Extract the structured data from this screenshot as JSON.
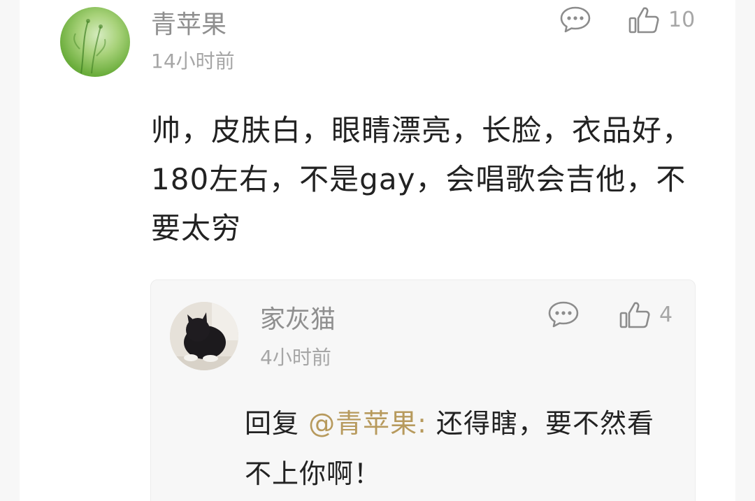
{
  "comment": {
    "username": "青苹果",
    "time": "14小时前",
    "like_count": "10",
    "text": "帅，皮肤白，眼睛漂亮，长脸，衣品好，180左右，不是gay，会唱歌会吉他，不要太穷",
    "icons": {
      "reply": "comment-bubble-icon",
      "like": "thumbs-up-icon"
    }
  },
  "reply": {
    "username": "家灰猫",
    "time": "4小时前",
    "like_count": "4",
    "prefix": "回复",
    "mention": "@青苹果:",
    "text": "还得瞎，要不然看不上你啊！",
    "icons": {
      "reply": "comment-bubble-icon",
      "like": "thumbs-up-icon"
    }
  },
  "colors": {
    "text": "#222222",
    "meta": "#a6a6a6",
    "username": "#8f8f8f",
    "mention": "#b79a5d",
    "card_bg": "#f7f7f7"
  }
}
